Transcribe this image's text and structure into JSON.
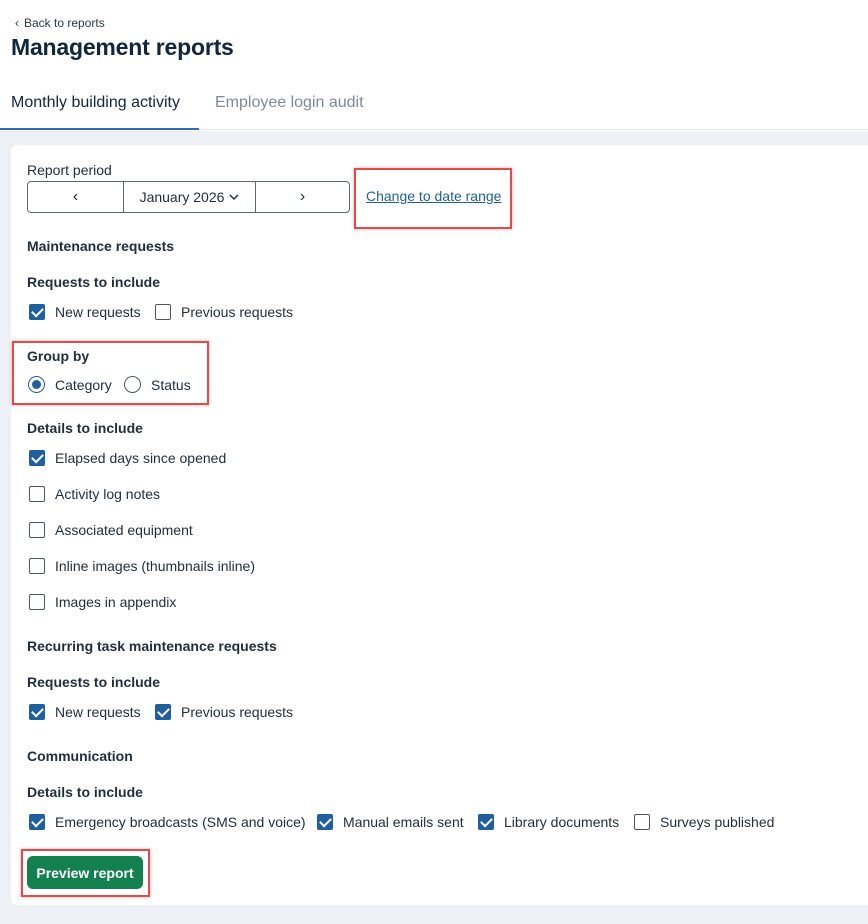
{
  "header": {
    "back_label": "Back to reports",
    "title": "Management reports"
  },
  "tabs": [
    {
      "label": "Monthly building activity",
      "active": true
    },
    {
      "label": "Employee login audit",
      "active": false
    }
  ],
  "report_period": {
    "label": "Report period",
    "month": "January 2026",
    "change_link": "Change to date range"
  },
  "maintenance": {
    "title": "Maintenance requests",
    "requests_label": "Requests to include",
    "requests": [
      {
        "label": "New requests",
        "checked": true
      },
      {
        "label": "Previous requests",
        "checked": false
      }
    ],
    "group_by_label": "Group by",
    "group_by": [
      {
        "label": "Category",
        "selected": true
      },
      {
        "label": "Status",
        "selected": false
      }
    ],
    "details_label": "Details to include",
    "details": [
      {
        "label": "Elapsed days since opened",
        "checked": true
      },
      {
        "label": "Activity log notes",
        "checked": false
      },
      {
        "label": "Associated equipment",
        "checked": false
      },
      {
        "label": "Inline images (thumbnails inline)",
        "checked": false
      },
      {
        "label": "Images in appendix",
        "checked": false
      }
    ]
  },
  "recurring": {
    "title": "Recurring task maintenance requests",
    "requests_label": "Requests to include",
    "requests": [
      {
        "label": "New requests",
        "checked": true
      },
      {
        "label": "Previous requests",
        "checked": true
      }
    ]
  },
  "communication": {
    "title": "Communication",
    "details_label": "Details to include",
    "details": [
      {
        "label": "Emergency broadcasts (SMS and voice)",
        "checked": true
      },
      {
        "label": "Manual emails sent",
        "checked": true
      },
      {
        "label": "Library documents",
        "checked": true
      },
      {
        "label": "Surveys published",
        "checked": false
      }
    ]
  },
  "actions": {
    "preview_label": "Preview report"
  },
  "colors": {
    "accent": "#1f5f9e",
    "primary_button": "#12804f",
    "highlight": "#e04b4b"
  }
}
